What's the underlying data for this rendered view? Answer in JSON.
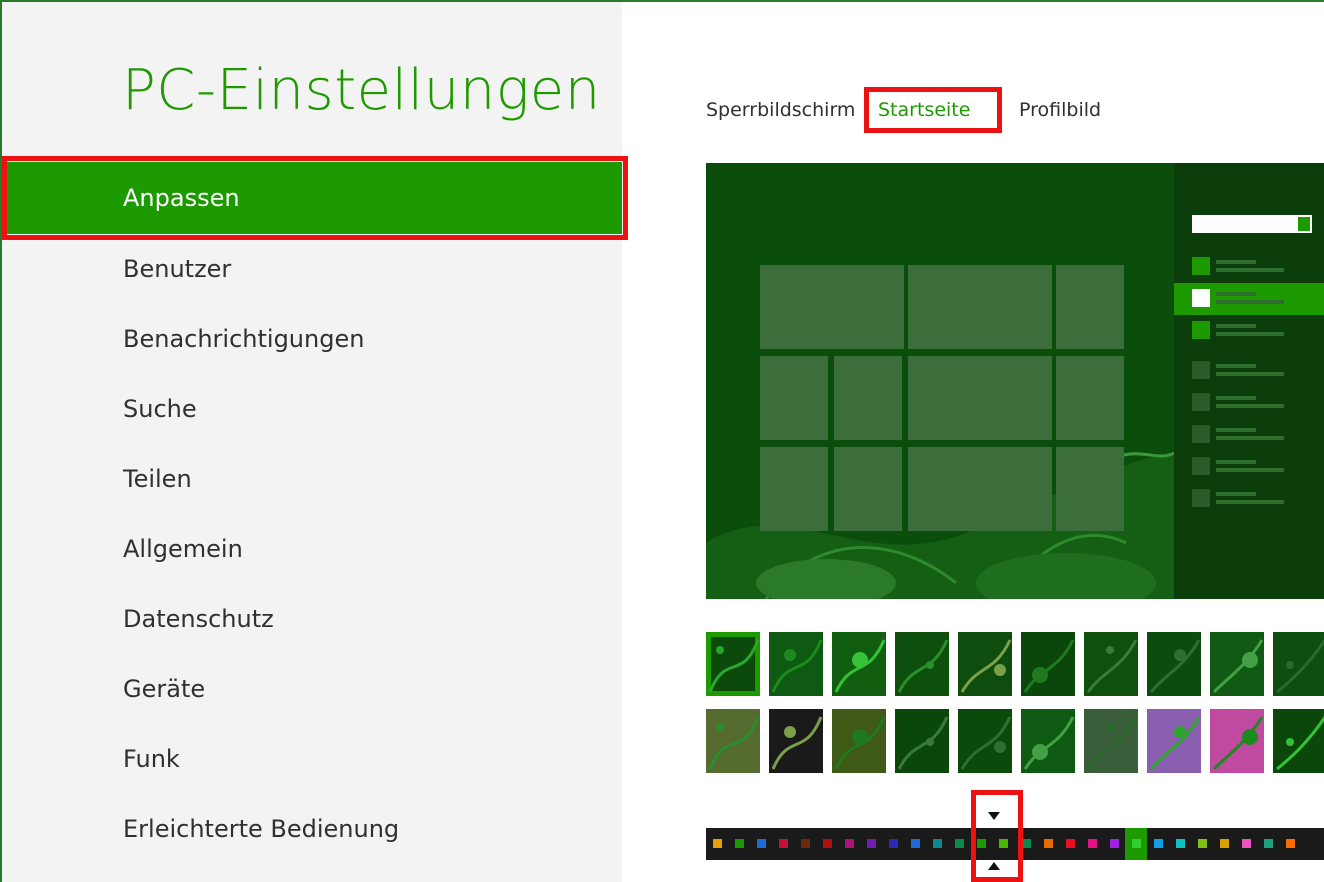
{
  "app": {
    "title": "PC-Einstellungen"
  },
  "nav": {
    "items": [
      {
        "label": "Anpassen",
        "active": true
      },
      {
        "label": "Benutzer"
      },
      {
        "label": "Benachrichtigungen"
      },
      {
        "label": "Suche"
      },
      {
        "label": "Teilen"
      },
      {
        "label": "Allgemein"
      },
      {
        "label": "Datenschutz"
      },
      {
        "label": "Geräte"
      },
      {
        "label": "Funk"
      },
      {
        "label": "Erleichterte Bedienung"
      }
    ]
  },
  "tabs": [
    {
      "label": "Sperrbildschirm"
    },
    {
      "label": "Startseite",
      "active": true
    },
    {
      "label": "Profilbild"
    }
  ],
  "colors": {
    "accent": "#1d9a00",
    "highlight": "#ee1111",
    "preview_bg": "#0b4e0b"
  },
  "patterns": {
    "selected_index": 0,
    "rows": [
      [
        "pattern-1",
        "pattern-2",
        "pattern-3",
        "pattern-4",
        "pattern-5",
        "pattern-6",
        "pattern-7",
        "pattern-8",
        "pattern-9",
        "pattern-10"
      ],
      [
        "pattern-11",
        "pattern-12",
        "pattern-13",
        "pattern-14",
        "pattern-15",
        "pattern-16",
        "pattern-17",
        "pattern-18",
        "pattern-19",
        "pattern-20"
      ]
    ]
  },
  "color_strip": {
    "selected_index": 19,
    "swatches": [
      "#e8a000",
      "#1d9a00",
      "#1e6ad6",
      "#c4103a",
      "#6b2b0b",
      "#b01010",
      "#b0107a",
      "#6e1fb0",
      "#2a2ab5",
      "#1e6ad6",
      "#0a8a8a",
      "#0a8a4a",
      "#1d9a00",
      "#4ab800",
      "#0a8a4a",
      "#e86a00",
      "#e81020",
      "#e8108a",
      "#a020e8",
      "#2080f0",
      "#10a0e8",
      "#10c0c0",
      "#80c010",
      "#d8a000",
      "#f050c0",
      "#20a080",
      "#ff6a00"
    ]
  }
}
